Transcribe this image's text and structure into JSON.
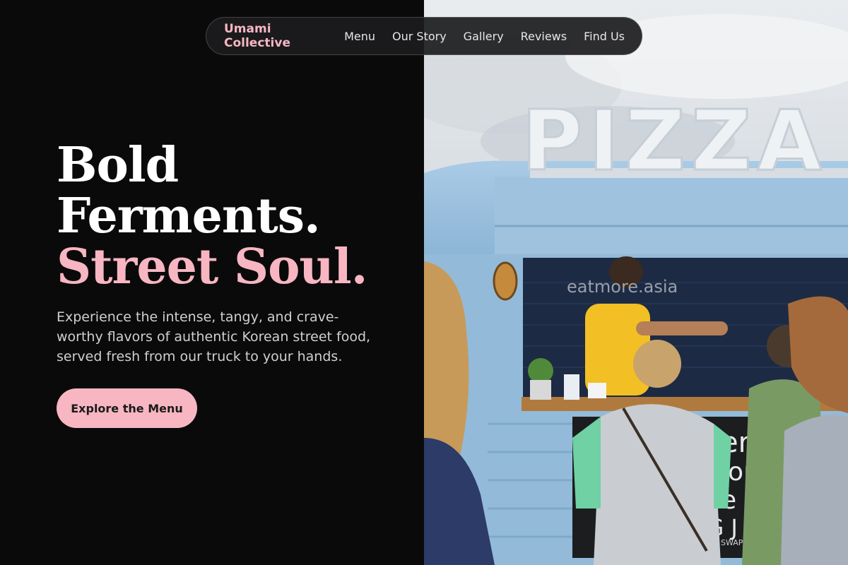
{
  "nav": {
    "brand": "Umami Collective",
    "links": [
      "Menu",
      "Our Story",
      "Gallery",
      "Reviews",
      "Find Us"
    ]
  },
  "hero": {
    "title_line1": "Bold",
    "title_line2": "Ferments.",
    "title_accent": "Street Soul.",
    "description": "Experience the intense, tangy, and crave-worthy flavors of authentic Korean street food, served fresh from our truck to your hands.",
    "cta_label": "Explore the Menu"
  },
  "photo": {
    "sign_text": "PIZZA",
    "watermark": "eatmore.asia",
    "chalkboard_lines": [
      "erit",
      "oni",
      "e -",
      "IG J",
      "SWAP FOR VE"
    ]
  },
  "colors": {
    "accent": "#f7b6c2",
    "background": "#0b0a0b",
    "truck_blue": "#9cc0dc"
  }
}
